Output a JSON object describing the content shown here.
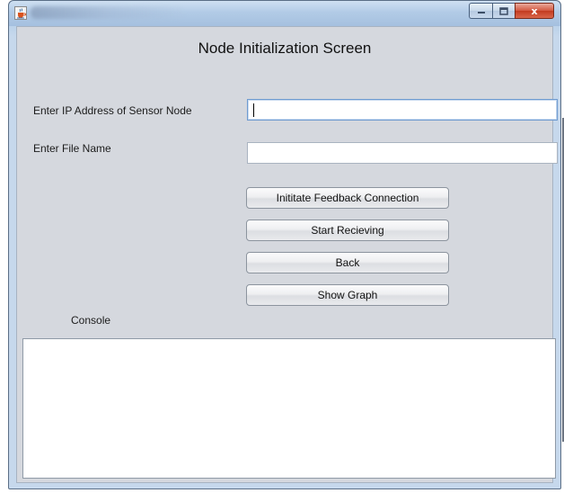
{
  "window": {
    "controls": {
      "minimize_icon": "minimize-icon",
      "maximize_icon": "maximize-icon",
      "close_icon": "close-icon",
      "close_glyph": "x",
      "close_color": "#c83c22"
    },
    "java_icon": "java-cup-icon"
  },
  "screen": {
    "title": "Node Initialization Screen"
  },
  "form": {
    "ip_label": "Enter IP Address of Sensor Node",
    "ip_value": "",
    "file_label": "Enter File Name",
    "file_value": ""
  },
  "buttons": {
    "initiate": "Inititate Feedback Connection",
    "start": "Start Recieving",
    "back": "Back",
    "graph": "Show Graph"
  },
  "console": {
    "label": "Console",
    "content": ""
  }
}
